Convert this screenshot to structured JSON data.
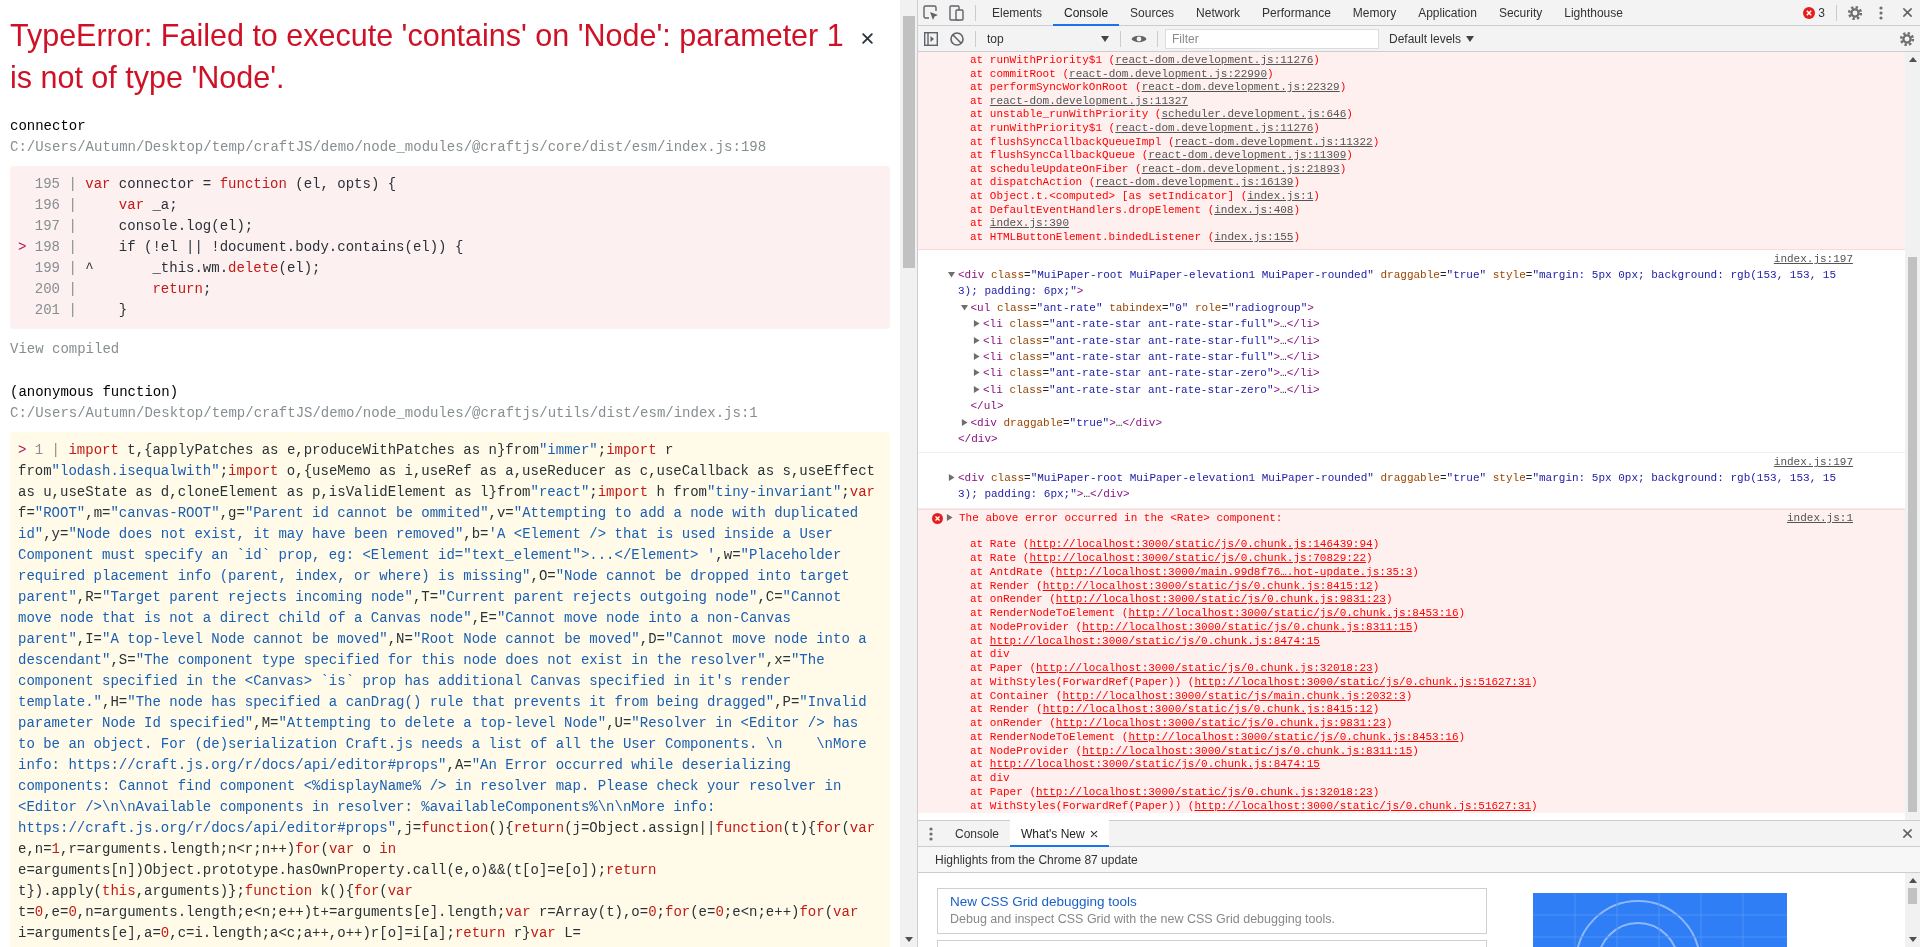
{
  "error_overlay": {
    "title": "TypeError: Failed to execute 'contains' on 'Node': parameter 1 is not of type 'Node'.",
    "frames": [
      {
        "function": "connector",
        "location": "C:/Users/Autumn/Desktop/temp/craftJS/demo/node_modules/@craftjs/core/dist/esm/index.js:198",
        "color": "#fcf0f1",
        "link": "View compiled",
        "lines": [
          {
            "gutter": "195 |",
            "code": "var connector = function (el, opts) {"
          },
          {
            "gutter": "196 |",
            "code": "    var _a;"
          },
          {
            "gutter": "197 |",
            "code": "    console.log(el);"
          },
          {
            "marker": ">",
            "gutter": "198 |",
            "code": "    if (!el || !document.body.contains(el)) {"
          },
          {
            "gutter": "199 |",
            "code": "^       _this.wm.delete(el);"
          },
          {
            "gutter": "200 |",
            "code": "        return;"
          },
          {
            "gutter": "201 |",
            "code": "    }"
          }
        ]
      },
      {
        "function": "(anonymous function)",
        "location": "C:/Users/Autumn/Desktop/temp/craftJS/demo/node_modules/@craftjs/utils/dist/esm/index.js:1",
        "color": "#fffbe8",
        "lines": [
          {
            "marker": ">",
            "gutter": "1 |",
            "code": "import t,{applyPatches as e,produceWithPatches as n}from\"immer\";import r from\"lodash.isequalwith\";import o,{useMemo as i,useRef as a,useReducer as c,useCallback as s,useEffect as u,useState as d,cloneElement as p,isValidElement as l}from\"react\";import h from\"tiny-invariant\";var f=\"ROOT\",m=\"canvas-ROOT\",g=\"Parent id cannot be ommited\",v=\"Attempting to add a node with duplicated id\",y=\"Node does not exist, it may have been removed\",b='A <Element /> that is used inside a User Component must specify an `id` prop, eg: <Element id=\"text_element\">...</Element> ',w=\"Placeholder required placement info (parent, index, or where) is missing\",O=\"Node cannot be dropped into target parent\",R=\"Target parent rejects incoming node\",T=\"Current parent rejects outgoing node\",C=\"Cannot move node that is not a direct child of a Canvas node\",E=\"Cannot move node into a non-Canvas parent\",I=\"A top-level Node cannot be moved\",N=\"Root Node cannot be moved\",D=\"Cannot move node into a descendant\",S=\"The component type specified for this node does not exist in the resolver\",x=\"The component specified in the <Canvas> `is` prop has additional Canvas specified in it's render template.\",H=\"The node has specified a canDrag() rule that prevents it from being dragged\",P=\"Invalid parameter Node Id specified\",M=\"Attempting to delete a top-level Node\",U=\"Resolver in <Editor /> has to be an object. For (de)serialization Craft.js needs a list of all the User Components. \\n    \\nMore info: https://craft.js.org/r/docs/api/editor#props\",A=\"An Error occurred while deserializing components: Cannot find component <%displayName% /> in resolver map. Please check your resolver in <Editor />\\n\\nAvailable components in resolver: %availableComponents%\\n\\nMore info: https://craft.js.org/r/docs/api/editor#props\",j=function(){return(j=Object.assign||function(t){for(var e,n=1,r=arguments.length;n<r;n++)for(var o in e=arguments[n])Object.prototype.hasOwnProperty.call(e,o)&&(t[o]=e[o]);return t}).apply(this,arguments)};function k(){for(var t=0,e=0,n=arguments.length;e<n;e++)t+=arguments[e].length;var r=Array(t),o=0;for(e=0;e<n;e++)for(var i=arguments[e],a=0,c=i.length;a<c;a++,o++)r[o]=i[a];return r}var L="
          }
        ]
      }
    ]
  },
  "devtools": {
    "tabs": [
      {
        "label": "Elements",
        "selected": false
      },
      {
        "label": "Console",
        "selected": true
      },
      {
        "label": "Sources",
        "selected": false
      },
      {
        "label": "Network",
        "selected": false
      },
      {
        "label": "Performance",
        "selected": false
      },
      {
        "label": "Memory",
        "selected": false
      },
      {
        "label": "Application",
        "selected": false
      },
      {
        "label": "Security",
        "selected": false
      },
      {
        "label": "Lighthouse",
        "selected": false
      }
    ],
    "error_count": "3",
    "console_toolbar": {
      "context": "top",
      "filter_placeholder": "Filter",
      "levels": "Default levels"
    },
    "messages": [
      {
        "kind": "stack",
        "frames": [
          {
            "text": "at runWithPriority$1 (",
            "link": "react-dom.development.js:11276",
            "end": ")"
          },
          {
            "text": "at commitRoot (",
            "link": "react-dom.development.js:22990",
            "end": ")"
          },
          {
            "text": "at performSyncWorkOnRoot (",
            "link": "react-dom.development.js:22329",
            "end": ")"
          },
          {
            "text": "at ",
            "link": "react-dom.development.js:11327"
          },
          {
            "text": "at unstable_runWithPriority (",
            "link": "scheduler.development.js:646",
            "end": ")"
          },
          {
            "text": "at runWithPriority$1 (",
            "link": "react-dom.development.js:11276",
            "end": ")"
          },
          {
            "text": "at flushSyncCallbackQueueImpl (",
            "link": "react-dom.development.js:11322",
            "end": ")"
          },
          {
            "text": "at flushSyncCallbackQueue (",
            "link": "react-dom.development.js:11309",
            "end": ")"
          },
          {
            "text": "at scheduleUpdateOnFiber (",
            "link": "react-dom.development.js:21893",
            "end": ")"
          },
          {
            "text": "at dispatchAction (",
            "link": "react-dom.development.js:16139",
            "end": ")"
          },
          {
            "text": "at Object.t.<computed> [as setIndicator] (",
            "link": "index.js:1",
            "end": ")"
          },
          {
            "text": "at DefaultEventHandlers.dropElement (",
            "link": "index.js:408",
            "end": ")"
          },
          {
            "text": "at ",
            "link": "index.js:390"
          },
          {
            "text": "at HTMLButtonElement.bindedListener (",
            "link": "index.js:155",
            "end": ")"
          }
        ]
      },
      {
        "kind": "dom",
        "source": "index.js:197",
        "nodes": [
          {
            "markup": "<div class=\"MuiPaper-root MuiPaper-elevation1 MuiPaper-rounded\" draggable=\"true\" style=\"margin: 5px 0px; background: rgb(153, 153, 153); padding: 6px;\">",
            "expanded": true,
            "closing": "</div>",
            "children": [
              {
                "markup": "<ul class=\"ant-rate\" tabindex=\"0\" role=\"radiogroup\">",
                "expanded": true,
                "closing": "</ul>",
                "children": [
                  {
                    "markup": "<li class=\"ant-rate-star ant-rate-star-full\">…</li>",
                    "expanded": false
                  },
                  {
                    "markup": "<li class=\"ant-rate-star ant-rate-star-full\">…</li>",
                    "expanded": false
                  },
                  {
                    "markup": "<li class=\"ant-rate-star ant-rate-star-full\">…</li>",
                    "expanded": false
                  },
                  {
                    "markup": "<li class=\"ant-rate-star ant-rate-star-zero\">…</li>",
                    "expanded": false
                  },
                  {
                    "markup": "<li class=\"ant-rate-star ant-rate-star-zero\">…</li>",
                    "expanded": false
                  }
                ]
              },
              {
                "markup": "<div draggable=\"true\">…</div>",
                "expanded": false
              }
            ]
          }
        ]
      },
      {
        "kind": "dom",
        "source": "index.js:197",
        "nodes": [
          {
            "markup": "<div class=\"MuiPaper-root MuiPaper-elevation1 MuiPaper-rounded\" draggable=\"true\" style=\"margin: 5px 0px; background: rgb(153, 153, 153); padding: 6px;\">…</div>",
            "expanded": false
          }
        ]
      },
      {
        "kind": "error",
        "expanded": false,
        "message": "The above error occurred in the <Rate> component:",
        "source": "index.js:1",
        "frames": [
          {
            "text": "at Rate (",
            "link": "http://localhost:3000/static/js/0.chunk.js:146439:94",
            "end": ")"
          },
          {
            "text": "at Rate (",
            "link": "http://localhost:3000/static/js/0.chunk.js:70829:22",
            "end": ")"
          },
          {
            "text": "at AntdRate (",
            "link": "http://localhost:3000/main.99d8f76….hot-update.js:35:3",
            "end": ")"
          },
          {
            "text": "at Render (",
            "link": "http://localhost:3000/static/js/0.chunk.js:8415:12",
            "end": ")"
          },
          {
            "text": "at onRender (",
            "link": "http://localhost:3000/static/js/0.chunk.js:9831:23",
            "end": ")"
          },
          {
            "text": "at RenderNodeToElement (",
            "link": "http://localhost:3000/static/js/0.chunk.js:8453:16",
            "end": ")"
          },
          {
            "text": "at NodeProvider (",
            "link": "http://localhost:3000/static/js/0.chunk.js:8311:15",
            "end": ")"
          },
          {
            "text": "at ",
            "link": "http://localhost:3000/static/js/0.chunk.js:8474:15"
          },
          {
            "text": "at div"
          },
          {
            "text": "at Paper (",
            "link": "http://localhost:3000/static/js/0.chunk.js:32018:23",
            "end": ")"
          },
          {
            "text": "at WithStyles(ForwardRef(Paper)) (",
            "link": "http://localhost:3000/static/js/0.chunk.js:51627:31",
            "end": ")"
          },
          {
            "text": "at Container (",
            "link": "http://localhost:3000/static/js/main.chunk.js:2032:3",
            "end": ")"
          },
          {
            "text": "at Render (",
            "link": "http://localhost:3000/static/js/0.chunk.js:8415:12",
            "end": ")"
          },
          {
            "text": "at onRender (",
            "link": "http://localhost:3000/static/js/0.chunk.js:9831:23",
            "end": ")"
          },
          {
            "text": "at RenderNodeToElement (",
            "link": "http://localhost:3000/static/js/0.chunk.js:8453:16",
            "end": ")"
          },
          {
            "text": "at NodeProvider (",
            "link": "http://localhost:3000/static/js/0.chunk.js:8311:15",
            "end": ")"
          },
          {
            "text": "at ",
            "link": "http://localhost:3000/static/js/0.chunk.js:8474:15"
          },
          {
            "text": "at div"
          },
          {
            "text": "at Paper (",
            "link": "http://localhost:3000/static/js/0.chunk.js:32018:23",
            "end": ")"
          },
          {
            "text": "at WithStyles(ForwardRef(Paper)) (",
            "link": "http://localhost:3000/static/js/0.chunk.js:51627:31",
            "end": ")"
          }
        ]
      }
    ],
    "drawer": {
      "tabs": [
        {
          "label": "Console",
          "selected": false,
          "closable": false
        },
        {
          "label": "What's New",
          "selected": true,
          "closable": true
        }
      ],
      "heading": "Highlights from the Chrome 87 update",
      "cards": [
        {
          "title": "New CSS Grid debugging tools",
          "description": "Debug and inspect CSS Grid with the new CSS Grid debugging tools."
        }
      ]
    }
  }
}
